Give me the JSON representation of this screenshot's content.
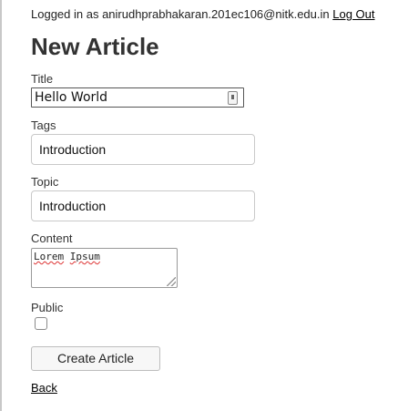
{
  "header": {
    "logged_in_text": "Logged in as anirudhprabhakaran.201ec106@nitk.edu.in",
    "logout_label": "Log Out"
  },
  "page_title": "New Article",
  "form": {
    "title": {
      "label": "Title",
      "value": "Hello World"
    },
    "tags": {
      "label": "Tags",
      "value": "Introduction"
    },
    "topic": {
      "label": "Topic",
      "value": "Introduction"
    },
    "content": {
      "label": "Content",
      "words": [
        "Lorem",
        "Ipsum"
      ]
    },
    "public": {
      "label": "Public",
      "checked": false
    },
    "submit_label": "Create Article"
  },
  "back_label": "Back",
  "icons": {
    "title_field_icon": "keyboard-icon"
  }
}
